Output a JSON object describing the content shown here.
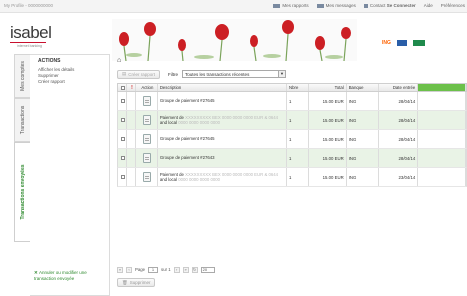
{
  "topbar": {
    "user_text": "My Profile - 0000000000",
    "links": [
      "Mes rapports",
      "Mes messages",
      "Contact",
      "Aide",
      "Préférences"
    ],
    "contact_extra": "Se Connecter"
  },
  "header": {
    "logo": "isabel",
    "logo_sub": "internet banking",
    "banks": [
      "ING"
    ]
  },
  "vtabs": [
    "Mes comptes",
    "Transactions",
    "Transactions envoyées"
  ],
  "actions": {
    "title": "ACTIONS",
    "items": [
      "Afficher les détails",
      "Supprimer",
      "Créer rapport"
    ],
    "bottom_text": "Annuler ou modifier une transaction envoyée"
  },
  "main": {
    "create_report": "Créer rapport",
    "filter_label": "Filtre",
    "filter_value": "Toutes les transactions récentes",
    "columns": [
      "Action",
      "Description",
      "Nbre",
      "Total",
      "Banque",
      "Date entrée"
    ],
    "rows": [
      {
        "desc1": "Groupe de paiement #27645",
        "desc2": "",
        "nb": "1",
        "total": "15.00 EUR",
        "bank": "ING",
        "date": "28/04/14"
      },
      {
        "desc1": "Paiement de ",
        "desc1_blur": "XXXXXXXXX BEX 0000 0000 0000 EUR & 0644",
        "desc2": "and local ",
        "desc2_blur": "0000 0000 0000 0000",
        "nb": "1",
        "total": "15.00 EUR",
        "bank": "ING",
        "date": "28/04/14"
      },
      {
        "desc1": "Groupe de paiement #27645",
        "desc2": "",
        "nb": "1",
        "total": "15.00 EUR",
        "bank": "ING",
        "date": "28/04/14"
      },
      {
        "desc1": "Groupe de paiement #27643",
        "desc2": "",
        "nb": "1",
        "total": "15.00 EUR",
        "bank": "ING",
        "date": "28/04/14"
      },
      {
        "desc1": "Paiement de ",
        "desc1_blur": "XXXXXXXXX BEX 0000 0000 0000 EUR & 0644",
        "desc2": "and local ",
        "desc2_blur": "0000 0000 0000 0000",
        "nb": "1",
        "total": "15.00 EUR",
        "bank": "ING",
        "date": "23/04/14"
      }
    ],
    "pager": {
      "page_label": "Page",
      "page_value": "1",
      "of_label": "sur 1",
      "per_page": "20"
    },
    "delete_label": "Supprimer"
  },
  "colors": {
    "accent": "#2f8a2f",
    "header_green": "#6cc04a",
    "row_alt": "#e9f3e6"
  }
}
